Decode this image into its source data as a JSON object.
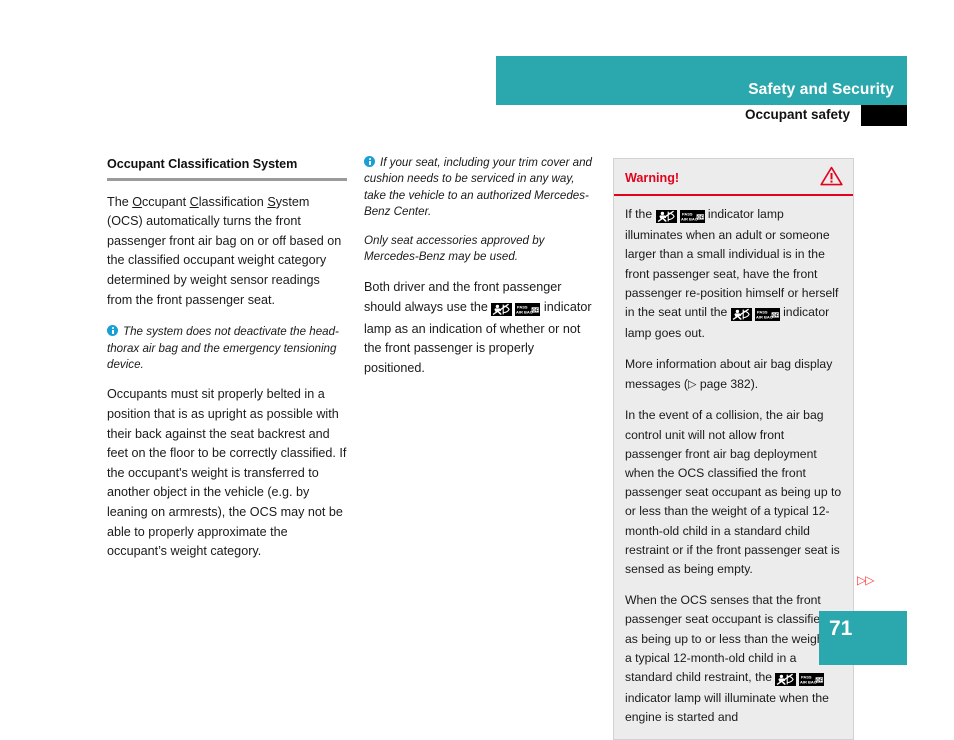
{
  "header": {
    "title": "Safety and Security",
    "subtitle": "Occupant safety",
    "band_color": "#2ba8ad",
    "tab_color": "#000000"
  },
  "left_column": {
    "heading": "Occupant Classification System",
    "paragraph1_pre": "The ",
    "paragraph1_u1": "O",
    "paragraph1_a": "ccupant ",
    "paragraph1_u2": "C",
    "paragraph1_b": "lassification ",
    "paragraph1_u3": "S",
    "paragraph1_c": "ystem (OCS) automatically turns the front passenger front air bag on or off based on the classified occupant weight category determined by weight sensor readings from the front passenger seat.",
    "note1": "The system does not deactivate the head-thorax air bag and the emergency tensioning device.",
    "paragraph2": "Occupants must sit properly belted in a position that is as upright as possible with their back against the seat backrest and feet on the floor to be correctly classified. If the occupant's weight is transferred to another object in the vehicle (e.g. by leaning on armrests), the OCS may not be able to properly approximate the occupant’s weight category."
  },
  "middle_column": {
    "note1": "If your seat, including your trim cover and cushion needs to be serviced in any way, take the vehicle to an authorized Mercedes-Benz Center.",
    "note2": "Only seat accessories approved by Mercedes-Benz may be used.",
    "paragraph1_pre": "Both driver and the front passenger should always use the ",
    "paragraph1_post": " indicator lamp as an indication of whether or not the front passenger is properly positioned."
  },
  "warning_box": {
    "title": "Warning!",
    "title_color": "#e2021b",
    "background_color": "#ececec",
    "icon": "warning-triangle-icon",
    "paragraph1_pre": "If the ",
    "paragraph1_mid": " indicator lamp illuminates when an adult or someone larger than a small individual is in the front passenger seat, have the front passenger re-position himself or herself in the seat until the ",
    "paragraph1_post": " indicator lamp goes out.",
    "paragraph2_pre": "More information about air bag display messages (",
    "paragraph2_arrow": "▷",
    "paragraph2_post": " page 382).",
    "paragraph3": "In the event of a collision, the air bag control unit will not allow front passenger front air bag deployment when the OCS classified the front passenger seat occupant as being up to or less than the weight of a typical 12-month-old child in a standard child restraint or if the front passenger seat is sensed as being empty.",
    "paragraph4_pre": "When the OCS senses that the front passenger seat occupant is classified as being up to or less than the weight of a typical 12-month-old child in a standard child restraint, the ",
    "paragraph4_post": " indicator lamp will illuminate when the engine is started and"
  },
  "continuation": {
    "marker": "▷▷",
    "color": "#ff3b3b"
  },
  "page_footer": {
    "number": "71",
    "box_color": "#2ba8ad"
  },
  "icons": {
    "lamp_child_seat": "child-seat-airbag-off-icon",
    "lamp_pass_air_bag_off": "pass-air-bag-off-icon",
    "info": "info-icon"
  }
}
